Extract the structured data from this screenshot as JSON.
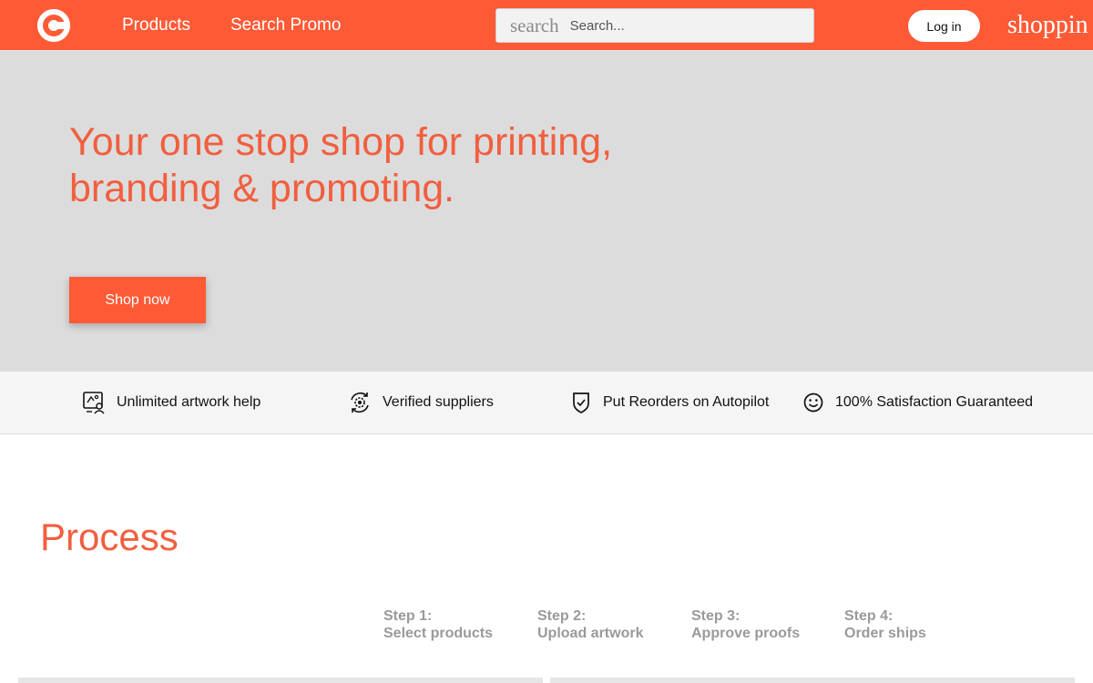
{
  "colors": {
    "brand": "#ff5a36",
    "headline": "#f15f3f",
    "hero_background": "#dcdcdc",
    "features_background": "#f5f5f5",
    "step_text": "#9a9a9a"
  },
  "header": {
    "logo_icon": "brand-logo-icon",
    "nav": [
      {
        "label": "Products"
      },
      {
        "label": "Search Promo"
      }
    ],
    "search": {
      "icon_label": "search",
      "placeholder": "Search...",
      "value": ""
    },
    "login_label": "Log in",
    "cart_label": "shoppin"
  },
  "hero": {
    "title": "Your one stop shop for printing, branding & promoting.",
    "cta_label": "Shop now"
  },
  "features": [
    {
      "icon": "artwork-help-icon",
      "label": "Unlimited artwork help"
    },
    {
      "icon": "verified-suppliers-icon",
      "label": "Verified suppliers"
    },
    {
      "icon": "shield-check-icon",
      "label": "Put Reorders on Autopilot"
    },
    {
      "icon": "smiley-icon",
      "label": "100% Satisfaction Guaranteed"
    }
  ],
  "process": {
    "title": "Process",
    "steps": [
      {
        "step": "Step 1:",
        "label": "Select products"
      },
      {
        "step": "Step 2:",
        "label": "Upload artwork"
      },
      {
        "step": "Step 3:",
        "label": "Approve proofs"
      },
      {
        "step": "Step 4:",
        "label": "Order ships"
      }
    ]
  }
}
